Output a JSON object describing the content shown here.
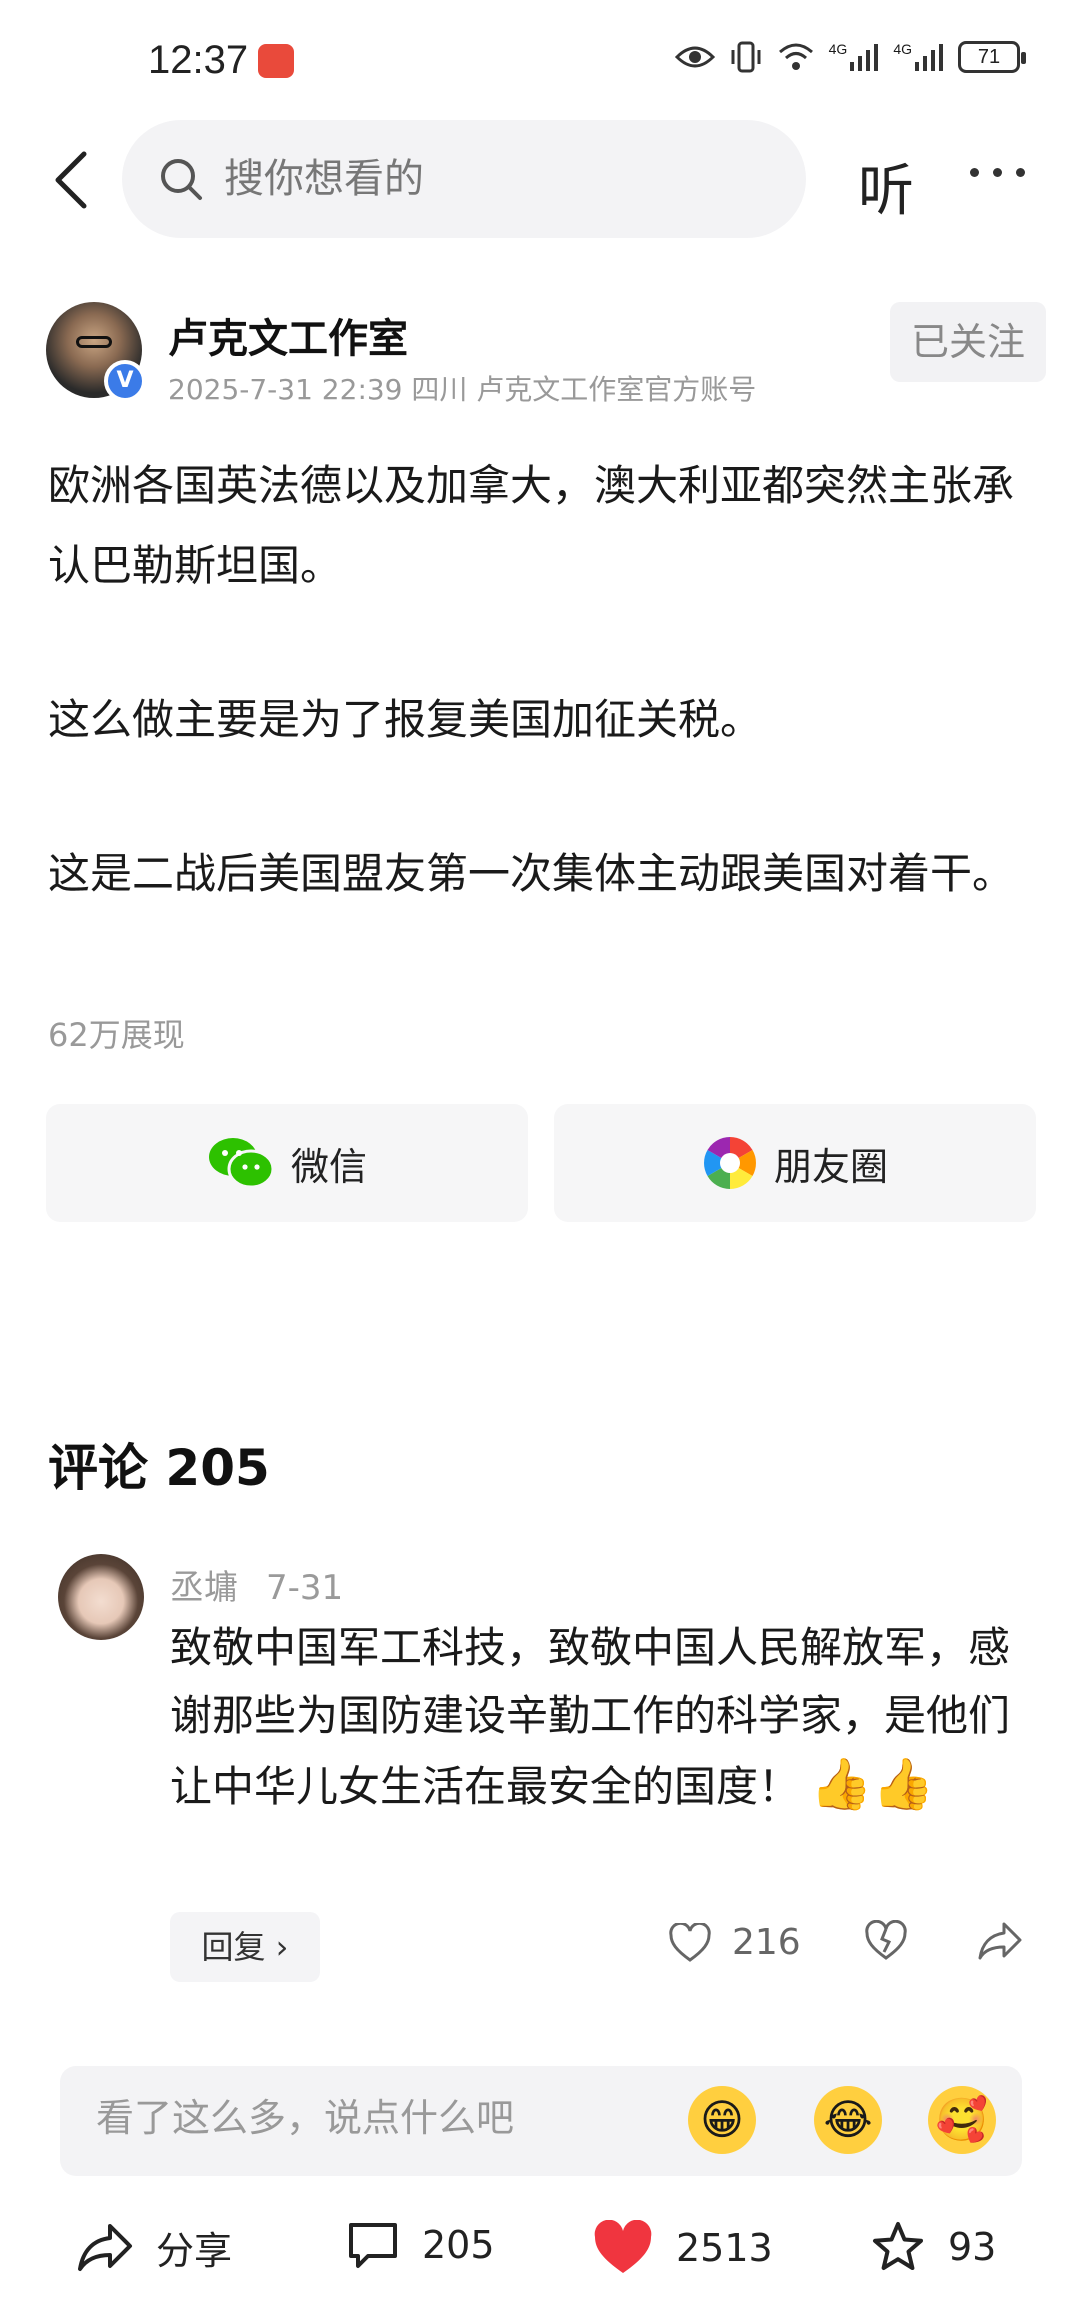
{
  "status_bar": {
    "time": "12:37",
    "network_1": "4G",
    "network_2": "4G",
    "battery": "71"
  },
  "nav": {
    "search_placeholder": "搜你想看的",
    "listen_label": "听"
  },
  "author": {
    "name": "卢克文工作室",
    "meta": "2025-7-31 22:39 四川 卢克文工作室官方账号",
    "follow_label": "已关注",
    "verified_mark": "V"
  },
  "post": {
    "paragraphs": [
      "欧洲各国英法德以及加拿大，澳大利亚都突然主张承认巴勒斯坦国。",
      "这么做主要是为了报复美国加征关税。",
      "这是二战后美国盟友第一次集体主动跟美国对着干。"
    ],
    "views": "62万展现"
  },
  "share": {
    "wechat_label": "微信",
    "moments_label": "朋友圈"
  },
  "comments": {
    "title": "评论 205",
    "items": [
      {
        "user": "丞墉",
        "date": "7-31",
        "text": "致敬中国军工科技，致敬中国人民解放军，感谢那些为国防建设辛勤工作的科学家，是他们让中华儿女生活在最安全的国度！",
        "emoji": "👍👍",
        "reply_label": "回复 ›",
        "likes": "216"
      }
    ]
  },
  "input": {
    "placeholder": "看了这么多，说点什么吧",
    "emojis": [
      "😁",
      "😂",
      "🥰"
    ]
  },
  "bottom_bar": {
    "share_label": "分享",
    "comments_count": "205",
    "likes_count": "2513",
    "favorites_count": "93"
  },
  "colors": {
    "like_red": "#f0353f",
    "verified_blue": "#3b7be8",
    "wechat_green": "#2dc100"
  }
}
